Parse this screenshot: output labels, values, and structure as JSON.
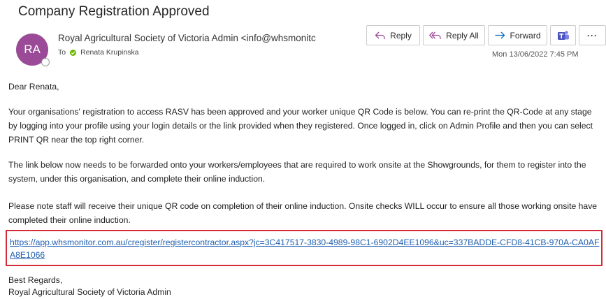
{
  "email": {
    "subject": "Company Registration Approved",
    "avatar_initials": "RA",
    "sender": "Royal Agricultural Society of Victoria Admin <info@whsmonitc",
    "to_prefix": "To",
    "recipient": "Renata Krupinska",
    "timestamp": "Mon 13/06/2022 7:45 PM"
  },
  "toolbar": {
    "reply_label": "Reply",
    "reply_all_label": "Reply All",
    "forward_label": "Forward",
    "more_label": "···"
  },
  "body": {
    "greeting": "Dear Renata,",
    "paragraph1": "Your organisations' registration to access RASV has been approved and your worker unique QR Code is below. You can re-print the QR-Code at any stage by logging into your profile using your login details or the link provided when they registered. Once logged in, click on Admin Profile and then you can select PRINT QR near the top right corner.",
    "paragraph2": "The link below now needs to be forwarded onto your workers/employees that are required to work onsite at the Showgrounds, for them to register into the system, under this organisation, and complete their online induction.",
    "paragraph3": "Please note staff will receive their unique QR code on completion of their online induction. Onsite checks WILL occur to ensure all those working onsite have completed their online induction.",
    "registration_link": "https://app.whsmonitor.com.au/cregister/registercontractor.aspx?jc=3C417517-3830-4989-98C1-6902D4EE1096&uc=337BADDE-CFD8-41CB-970A-CA0AFA8E1066",
    "signoff": "Best Regards,",
    "signature": "Royal Agricultural Society of Victoria Admin"
  },
  "colors": {
    "avatar": "#9b4a97",
    "accent": "#0f6cbd",
    "link": "#1f5fb0",
    "highlight_box": "#d42c3a",
    "status_available": "#6bb700"
  },
  "icons": [
    "reply-icon",
    "reply-all-icon",
    "forward-icon",
    "teams-icon",
    "more-icon",
    "presence-available-icon"
  ]
}
